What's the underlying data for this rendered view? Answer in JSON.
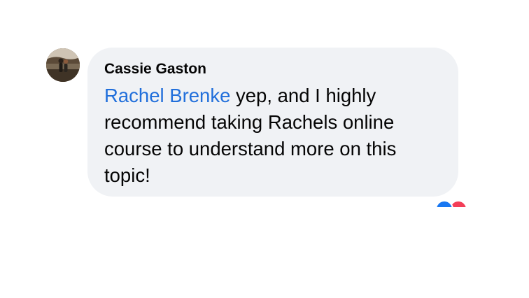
{
  "comment": {
    "author": "Cassie Gaston",
    "mention": "Rachel Brenke",
    "text": " yep, and I highly recommend taking Rachels online course to understand more on this topic!"
  },
  "reactions": {
    "icons": [
      "like-icon",
      "love-icon"
    ],
    "colors": {
      "like": "#1877f2",
      "love": "#f33e58"
    }
  },
  "colors": {
    "bubble": "#f0f2f5",
    "mention": "#216fdb",
    "text": "#050505"
  }
}
